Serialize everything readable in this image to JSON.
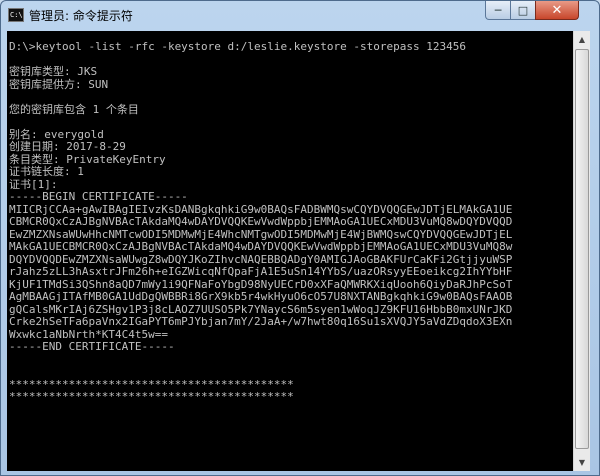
{
  "window": {
    "title": "管理员: 命令提示符",
    "icon_text": "C:\\",
    "buttons": {
      "minimize": "─",
      "maximize": "□",
      "close": "✕"
    }
  },
  "console": {
    "lines": [
      "D:\\>keytool -list -rfc -keystore d:/leslie.keystore -storepass 123456",
      "",
      "密钥库类型: JKS",
      "密钥库提供方: SUN",
      "",
      "您的密钥库包含 1 个条目",
      "",
      "别名: everygold",
      "创建日期: 2017-8-29",
      "条目类型: PrivateKeyEntry",
      "证书链长度: 1",
      "证书[1]:",
      "-----BEGIN CERTIFICATE-----",
      "MIICRjCCAa+gAwIBAgIEIvzKsDANBgkqhkiG9w0BAQsFADBWMQswCQYDVQQGEwJDTjELMAkGA1UE",
      "CBMCR0QxCzAJBgNVBAcTAkdaMQ4wDAYDVQQKEwVwdWppbjEMMAoGA1UECxMDU3VuMQ8wDQYDVQQD",
      "EwZMZXNsaWUwHhcNMTcwODI5MDMwMjE4WhcNMTgwODI5MDMwMjE4WjBWMQswCQYDVQQGEwJDTjEL",
      "MAkGA1UECBMCR0QxCzAJBgNVBAcTAkdaMQ4wDAYDVQQKEwVwdWppbjEMMAoGA1UECxMDU3VuMQ8w",
      "DQYDVQQDEwZMZXNsaWUwgZ8wDQYJKoZIhvcNAQEBBQADgY0AMIGJAoGBAKFUrCaKFi2GtjjyuWSP",
      "rJahz5zLL3hAsxtrJFm26h+eIGZWicqNfQpaFjA1E5uSn14YYbS/uazORsyyEEoeikcg2IhYYbHF",
      "KjUF1TMdSi3QShn8aQD7mWy1i9QFNaFoYbgD98NyUECrD0xXFaQMWRKXiqUooh6QiyDaRJhPcSoT",
      "AgMBAAGjITAfMB0GA1UdDgQWBBRi8GrX9kb5r4wkHyuO6cO57U8NXTANBgkqhkiG9w0BAQsFAAOB",
      "gQCalsMKrIAj6ZSHgv1P3j8cLAOZ7UUSO5Pk7YNaycS6m5syen1wWoqJZ9KFU16HbbB0mxUNrJKD",
      "Crke2hSeTFa6paVnx2IGaPYT6mPJYbjan7mY/2JaA+/w7hwt80q16Su1sXVQJY5aVdZDqdoX3EXn",
      "Wxwkc1aNbNrth*KT4C4t5w==",
      "-----END CERTIFICATE-----",
      "",
      "",
      "*******************************************",
      "*******************************************"
    ]
  }
}
